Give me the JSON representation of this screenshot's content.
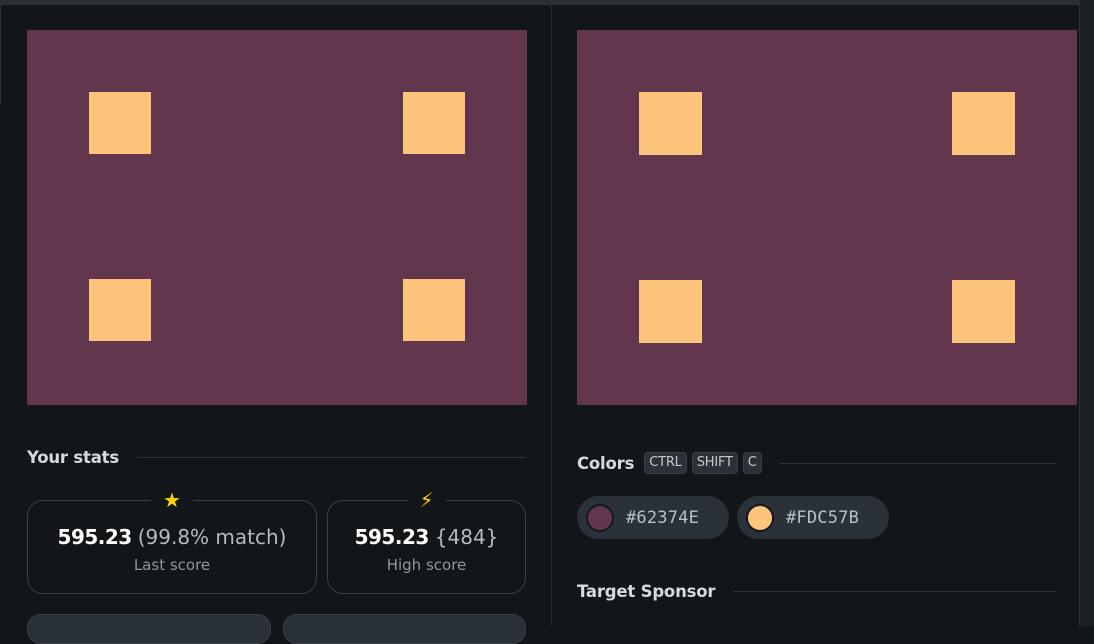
{
  "stats": {
    "heading": "Your stats",
    "last": {
      "icon": "star-icon",
      "glyph": "★",
      "score": "595.23",
      "detail": "(99.8% match)",
      "label": "Last score"
    },
    "high": {
      "icon": "lightning-icon",
      "glyph": "⚡",
      "score": "595.23",
      "detail": "{484}",
      "label": "High score"
    }
  },
  "colors": {
    "heading": "Colors",
    "shortcut": [
      "CTRL",
      "SHIFT",
      "C"
    ],
    "items": [
      {
        "hex": "#62374E",
        "swatch": "#62374E"
      },
      {
        "hex": "#FDC57B",
        "swatch": "#FDC57B"
      }
    ]
  },
  "sponsor": {
    "heading": "Target Sponsor"
  },
  "palette": {
    "background": "#62374E",
    "square": "#FDC57B",
    "page": "#131619",
    "accent": "#FFD400"
  }
}
